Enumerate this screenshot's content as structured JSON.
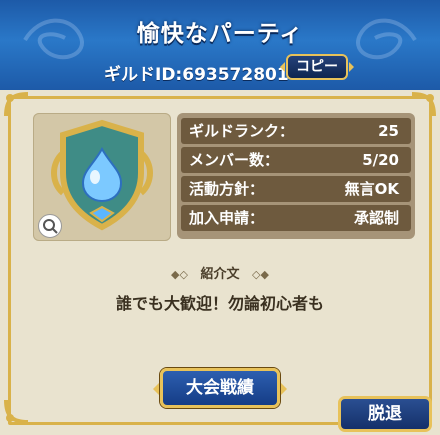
{
  "header": {
    "title": "愉快なパーティ",
    "guild_id": "ギルドID:693572801",
    "copy_label": "コピー"
  },
  "info": {
    "rows": [
      {
        "label": "ギルドランク：",
        "value": "25"
      },
      {
        "label": "メンバー数：",
        "value": "5/20"
      },
      {
        "label": "活動方針：",
        "value": "無言OK"
      },
      {
        "label": "加入申請：",
        "value": "承認制"
      }
    ]
  },
  "intro": {
    "heading": "紹介文",
    "text": "誰でも大歓迎！勿論初心者も"
  },
  "buttons": {
    "results": "大会戦績",
    "leave": "脱退"
  },
  "colors": {
    "header_blue": "#1d5aa8",
    "gold": "#e8c25a",
    "panel": "#e9e3cf",
    "row": "#6e5a3e"
  },
  "icons": {
    "emblem": "shield-slime-emblem-icon",
    "zoom": "magnifier-icon"
  }
}
